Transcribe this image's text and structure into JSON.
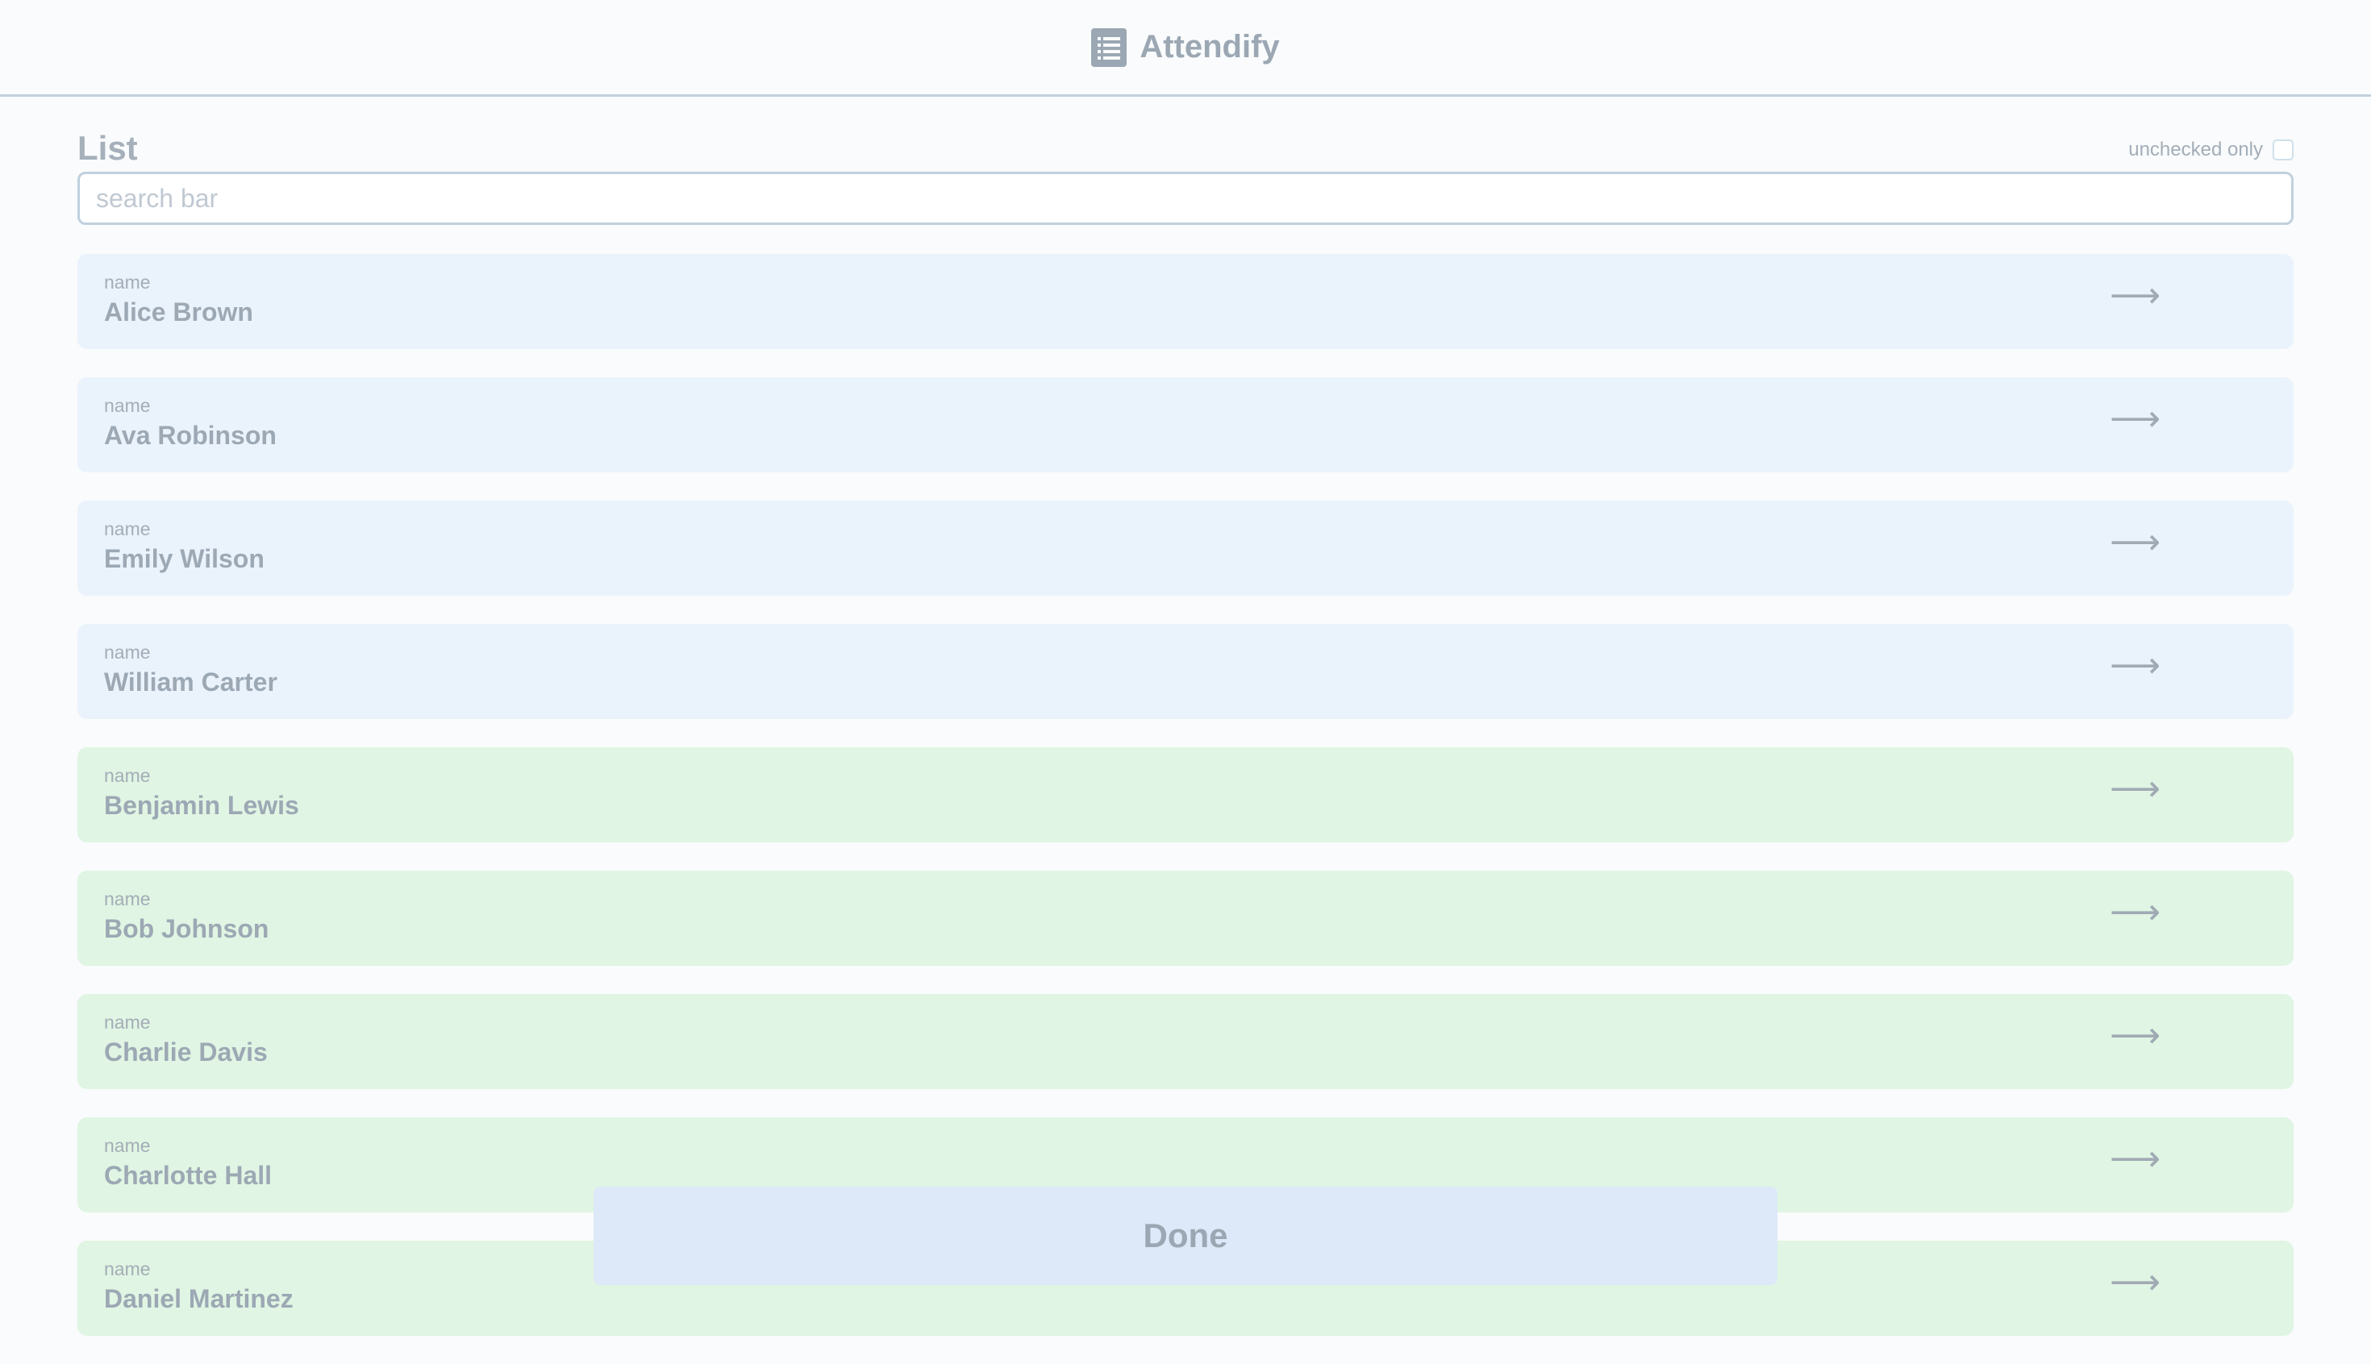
{
  "header": {
    "title": "Attendify",
    "icon": "list-icon"
  },
  "list": {
    "title": "List",
    "filter_label": "unchecked only",
    "filter_checked": false
  },
  "search": {
    "placeholder": "search bar",
    "value": ""
  },
  "rows": [
    {
      "label": "name",
      "name": "Alice Brown",
      "status": "blue"
    },
    {
      "label": "name",
      "name": "Ava Robinson",
      "status": "blue"
    },
    {
      "label": "name",
      "name": "Emily Wilson",
      "status": "blue"
    },
    {
      "label": "name",
      "name": "William Carter",
      "status": "blue"
    },
    {
      "label": "name",
      "name": "Benjamin Lewis",
      "status": "green"
    },
    {
      "label": "name",
      "name": "Bob Johnson",
      "status": "green"
    },
    {
      "label": "name",
      "name": "Charlie Davis",
      "status": "green"
    },
    {
      "label": "name",
      "name": "Charlotte Hall",
      "status": "green"
    },
    {
      "label": "name",
      "name": "Daniel Martinez",
      "status": "green"
    }
  ],
  "row_arrow": "⟶",
  "done_label": "Done",
  "colors": {
    "blue_row": "#eaf3fc",
    "green_row": "#e0f5e3",
    "done_button": "#dde9f8"
  }
}
